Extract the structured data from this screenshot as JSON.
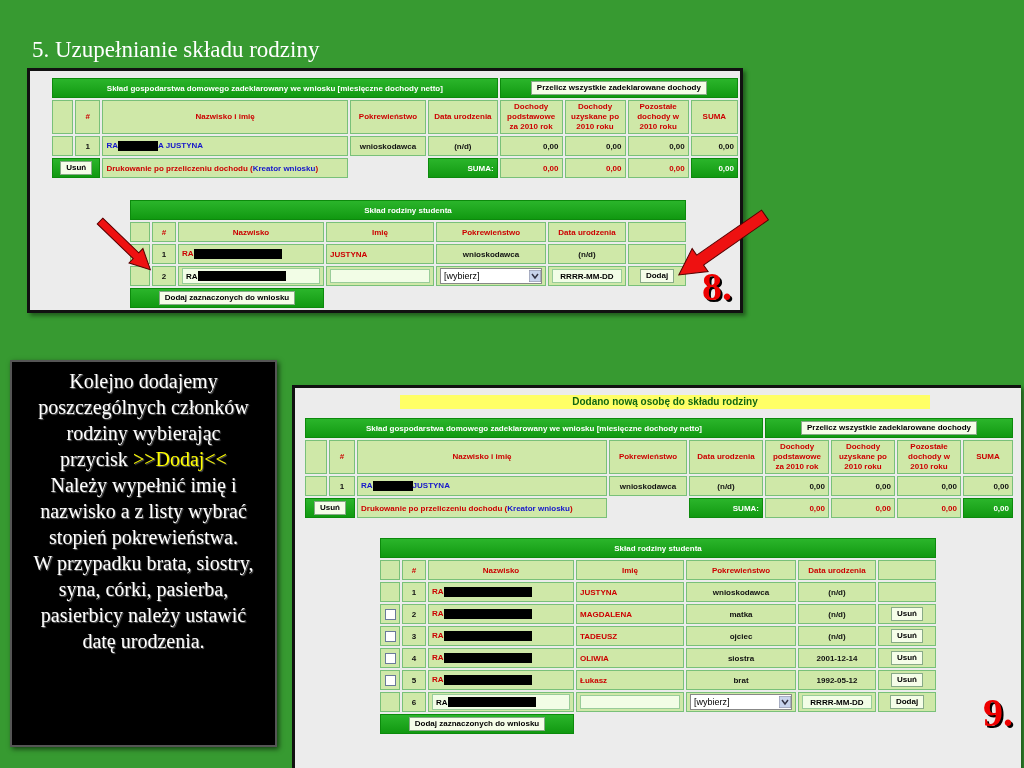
{
  "title": "5. Uzupełnianie składu rodziny",
  "screens": [
    {
      "number": "8.",
      "arrows": true,
      "income_table": {
        "title": "Skład gospodarstwa domowego zadeklarowany we wniosku [miesięczne dochody netto]",
        "recalc_button": "Przelicz wszystkie zadeklarowane dochody",
        "columns": [
          "#",
          "Nazwisko i imię",
          "Pokrewieństwo",
          "Data urodzenia",
          "Dochody podstawowe za 2010 rok",
          "Dochody uzyskane po 2010 roku",
          "Pozostałe dochody w 2010 roku",
          "SUMA"
        ],
        "rows": [
          {
            "number": "1",
            "name_prefix": "RA",
            "name_suffix": "A JUSTYNA",
            "relation": "wnioskodawca",
            "birth_date": "(n/d)",
            "values": [
              "0,00",
              "0,00",
              "0,00",
              "0,00"
            ]
          }
        ],
        "footer": {
          "delete_button": "Usuń",
          "print_text": "Drukowanie po przeliczeniu dochodu (",
          "print_link": "Kreator wniosku",
          "print_close": ")",
          "sum_label": "SUMA:",
          "sums": [
            "0,00",
            "0,00",
            "0,00",
            "0,00"
          ]
        }
      },
      "family_table": {
        "title": "Skład rodziny studenta",
        "columns": [
          "#",
          "Nazwisko",
          "Imię",
          "Pokrewieństwo",
          "Data urodzenia"
        ],
        "rows": [
          {
            "kind": "entry",
            "number": "1",
            "surname": "RA",
            "first_name": "JUSTYNA",
            "relation": "wnioskodawca",
            "birth_date": "(n/d)"
          },
          {
            "kind": "new",
            "number": "2",
            "surname": "RA",
            "relation": "[wybierz]",
            "date_placeholder": "RRRR-MM-DD",
            "add_button": "Dodaj"
          }
        ],
        "footer_button": "Dodaj zaznaczonych do wniosku"
      }
    },
    {
      "number": "9.",
      "arrows": false,
      "banner": "Dodano nową osobę do składu rodziny",
      "income_table": {
        "title": "Skład gospodarstwa domowego zadeklarowany we wniosku [miesięczne dochody netto]",
        "recalc_button": "Przelicz wszystkie zadeklarowane dochody",
        "columns": [
          "#",
          "Nazwisko i imię",
          "Pokrewieństwo",
          "Data urodzenia",
          "Dochody podstawowe za 2010 rok",
          "Dochody uzyskane po 2010 roku",
          "Pozostałe dochody w 2010 roku",
          "SUMA"
        ],
        "rows": [
          {
            "number": "1",
            "name_prefix": "RA",
            "name_suffix": "JUSTYNA",
            "relation": "wnioskodawca",
            "birth_date": "(n/d)",
            "values": [
              "0,00",
              "0,00",
              "0,00",
              "0,00"
            ]
          }
        ],
        "footer": {
          "delete_button": "Usuń",
          "print_text": "Drukowanie po przeliczeniu dochodu (",
          "print_link": "Kreator wniosku",
          "print_close": ")",
          "sum_label": "SUMA:",
          "sums": [
            "0,00",
            "0,00",
            "0,00",
            "0,00"
          ]
        }
      },
      "family_table": {
        "title": "Skład rodziny studenta",
        "columns": [
          "#",
          "Nazwisko",
          "Imię",
          "Pokrewieństwo",
          "Data urodzenia"
        ],
        "rows": [
          {
            "kind": "entry",
            "number": "1",
            "surname": "RA",
            "first_name": "JUSTYNA",
            "relation": "wnioskodawca",
            "birth_date": "(n/d)"
          },
          {
            "kind": "entry",
            "number": "2",
            "surname": "RA",
            "first_name": "MAGDALENA",
            "relation": "matka",
            "birth_date": "(n/d)",
            "checked": false,
            "delete_button": "Usuń"
          },
          {
            "kind": "entry",
            "number": "3",
            "surname": "RA",
            "first_name": "TADEUSZ",
            "relation": "ojciec",
            "birth_date": "(n/d)",
            "checked": false,
            "delete_button": "Usuń"
          },
          {
            "kind": "entry",
            "number": "4",
            "surname": "RA",
            "first_name": "OLIWIA",
            "relation": "siostra",
            "birth_date": "2001-12-14",
            "checked": false,
            "delete_button": "Usuń"
          },
          {
            "kind": "entry",
            "number": "5",
            "surname": "RA",
            "first_name": "Łukasz",
            "relation": "brat",
            "birth_date": "1992-05-12",
            "checked": false,
            "delete_button": "Usuń"
          },
          {
            "kind": "new",
            "number": "6",
            "surname": "RA",
            "relation": "[wybierz]",
            "date_placeholder": "RRRR-MM-DD",
            "add_button": "Dodaj"
          }
        ],
        "footer_button": "Dodaj zaznaczonych do wniosku"
      }
    }
  ],
  "instructions": [
    [
      {
        "text": "Kolejno dodajemy poszczególnych członków rodziny wybierając przycisk ",
        "highlight": false
      },
      {
        "text": ">>Dodaj<<",
        "highlight": true
      },
      {
        "text": " Należy wypełnić imię i nazwisko a z listy wybrać stopień pokrewieństwa.",
        "highlight": false
      }
    ],
    [
      {
        "text": "W przypadku brata, siostry, syna, córki, pasierba, pasierbicy należy ustawić datę urodzenia.",
        "highlight": false
      }
    ]
  ]
}
